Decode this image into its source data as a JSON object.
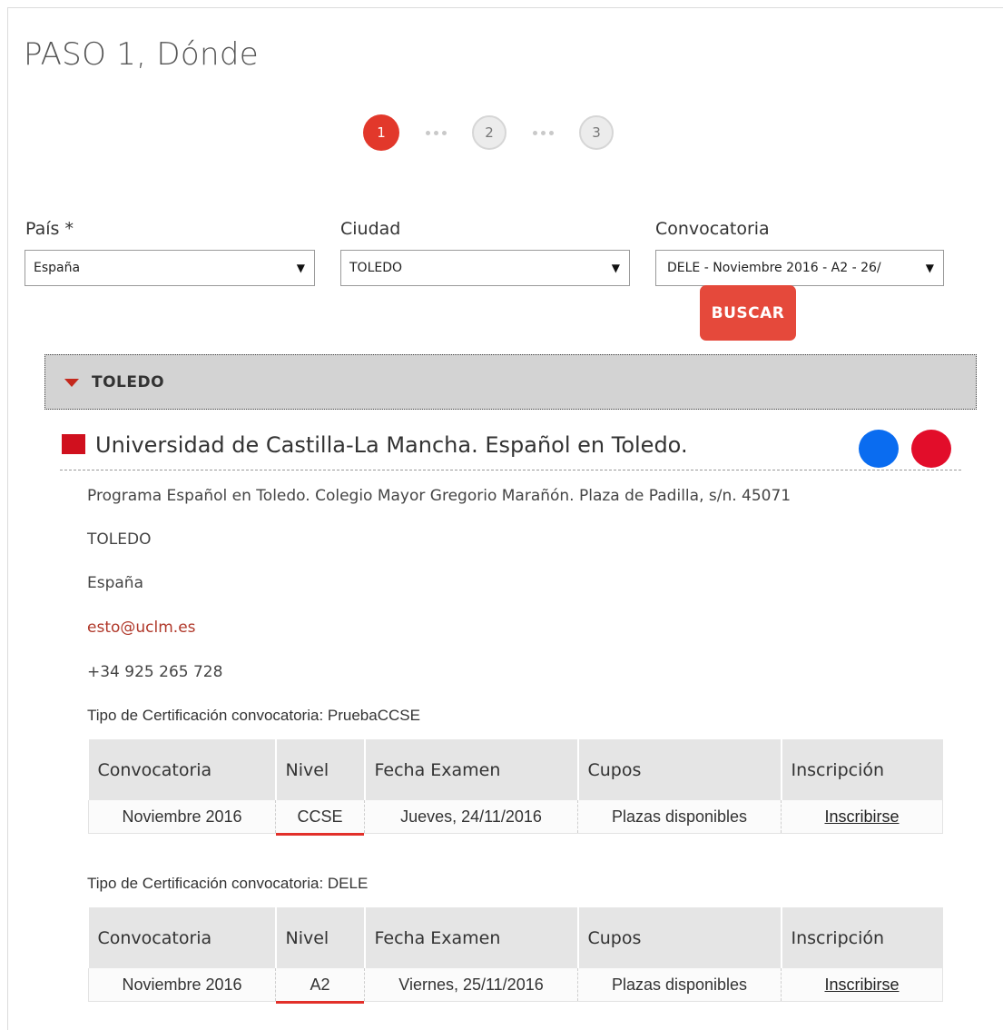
{
  "page": {
    "title": "PASO 1, Dónde"
  },
  "stepper": {
    "steps": [
      "1",
      "2",
      "3"
    ],
    "active_index": 0
  },
  "filters": {
    "pais": {
      "label": "País *",
      "value": "España"
    },
    "ciudad": {
      "label": "Ciudad",
      "value": "TOLEDO"
    },
    "convocatoria": {
      "label": "Convocatoria",
      "value": "DELE - Noviembre 2016 - A2 - 26/"
    },
    "search_label": "BUSCAR"
  },
  "results": {
    "city_header": "TOLEDO",
    "center": {
      "name": "Universidad de Castilla-La Mancha. Español en Toledo.",
      "address": "Programa Español en Toledo. Colegio Mayor Gregorio Marañón. Plaza de Padilla, s/n. 45071",
      "city": "TOLEDO",
      "country": "España",
      "email": "esto@uclm.es",
      "phone": "+34 925 265 728"
    },
    "columns": [
      "Convocatoria",
      "Nivel",
      "Fecha Examen",
      "Cupos",
      "Inscripción"
    ],
    "certifications": [
      {
        "type_label": "Tipo de Certificación convocatoria: PruebaCCSE",
        "row": {
          "convocatoria": "Noviembre 2016",
          "nivel": "CCSE",
          "fecha": "Jueves, 24/11/2016",
          "cupos": "Plazas disponibles",
          "inscripcion": "Inscribirse"
        }
      },
      {
        "type_label": "Tipo de Certificación convocatoria: DELE",
        "row": {
          "convocatoria": "Noviembre 2016",
          "nivel": "A2",
          "fecha": "Viernes, 25/11/2016",
          "cupos": "Plazas disponibles",
          "inscripcion": "Inscribirse"
        }
      }
    ]
  },
  "colors": {
    "accent_red": "#e2382b",
    "available_green": "#3b8a2c",
    "email_red": "#b0382a",
    "blue_dot": "#0a6cf0",
    "red_dot": "#e20d2a"
  },
  "icons": {
    "caret": "caret-down-icon",
    "center_marker": "square-marker-icon"
  }
}
